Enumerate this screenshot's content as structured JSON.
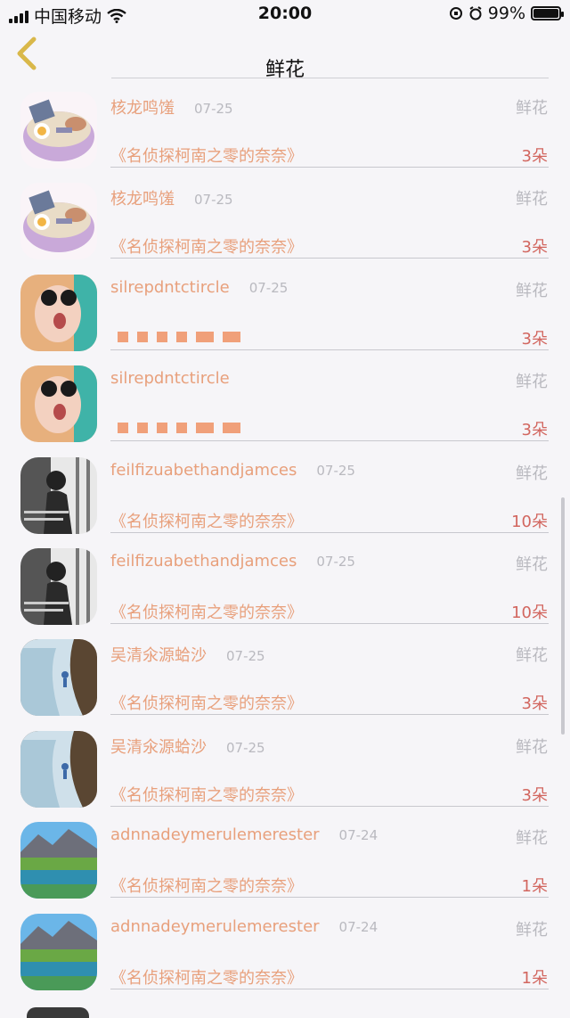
{
  "status": {
    "carrier": "中国移动",
    "time": "20:00",
    "battery_text": "99%",
    "battery_level": 0.99
  },
  "nav": {
    "title": "鲜花",
    "back_icon": "chevron-left-icon"
  },
  "rows": [
    {
      "name": "核龙鸣馐",
      "date": "07-25",
      "type": "鲜花",
      "title": "《名侦探柯南之零的奈奈》",
      "count": "3朵",
      "avatar": "ramen"
    },
    {
      "name": "核龙鸣馐",
      "date": "07-25",
      "type": "鲜花",
      "title": "《名侦探柯南之零的奈奈》",
      "count": "3朵",
      "avatar": "ramen"
    },
    {
      "name": "silrepdntctircle",
      "date": "07-25",
      "type": "鲜花",
      "title": "",
      "count": "3朵",
      "avatar": "girl"
    },
    {
      "name": "silrepdntctircle",
      "date": "",
      "type": "鲜花",
      "title": "",
      "count": "3朵",
      "avatar": "girl"
    },
    {
      "name": "feilfizuabethandjamces",
      "date": "07-25",
      "type": "鲜花",
      "title": "《名侦探柯南之零的奈奈》",
      "count": "10朵",
      "avatar": "bw"
    },
    {
      "name": "feilfizuabethandjamces",
      "date": "07-25",
      "type": "鲜花",
      "title": "《名侦探柯南之零的奈奈》",
      "count": "10朵",
      "avatar": "bw"
    },
    {
      "name": "吴清氽源蛤沙",
      "date": "07-25",
      "type": "鲜花",
      "title": "《名侦探柯南之零的奈奈》",
      "count": "3朵",
      "avatar": "beach"
    },
    {
      "name": "吴清氽源蛤沙",
      "date": "07-25",
      "type": "鲜花",
      "title": "《名侦探柯南之零的奈奈》",
      "count": "3朵",
      "avatar": "beach"
    },
    {
      "name": "adnnadeymerulemerester",
      "date": "07-24",
      "type": "鲜花",
      "title": "《名侦探柯南之零的奈奈》",
      "count": "1朵",
      "avatar": "lake"
    },
    {
      "name": "adnnadeymerulemerester",
      "date": "07-24",
      "type": "鲜花",
      "title": "《名侦探柯南之零的奈奈》",
      "count": "1朵",
      "avatar": "lake"
    }
  ],
  "colors": {
    "accent": "#e8a07c",
    "count": "#d2665f",
    "muted": "#b9b9bf",
    "back": "#d9b84a"
  }
}
